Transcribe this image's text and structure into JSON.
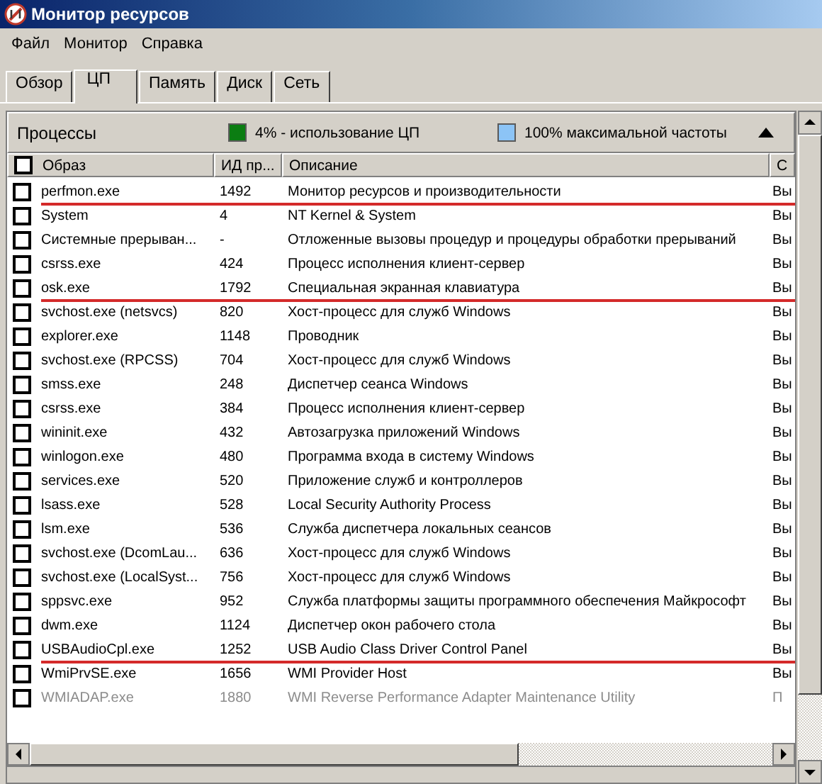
{
  "window": {
    "title": "Монитор ресурсов"
  },
  "menu": [
    "Файл",
    "Монитор",
    "Справка"
  ],
  "tabs": [
    {
      "label": "Обзор",
      "selected": false
    },
    {
      "label": "ЦП",
      "selected": true
    },
    {
      "label": "Память",
      "selected": false
    },
    {
      "label": "Диск",
      "selected": false
    },
    {
      "label": "Сеть",
      "selected": false
    }
  ],
  "section": {
    "title": "Процессы",
    "expanded": true,
    "legend": [
      {
        "text": "4% - использование ЦП",
        "color": "#0b7d12"
      },
      {
        "text": "100% максимальной частоты",
        "color": "#8cc4f6"
      }
    ]
  },
  "table": {
    "columns": [
      "Образ",
      "ИД пр...",
      "Описание",
      "С"
    ],
    "all_checked": false,
    "rows": [
      {
        "image": "perfmon.exe",
        "pid": "1492",
        "description": "Монитор ресурсов и производительности",
        "column_4": "Вы",
        "checked": false,
        "greyed": false,
        "marked": true
      },
      {
        "image": "System",
        "pid": "4",
        "description": "NT Kernel & System",
        "column_4": "Вы",
        "checked": false,
        "greyed": false,
        "marked": false
      },
      {
        "image": "Системные прерыван...",
        "pid": "-",
        "description": "Отложенные вызовы процедур и процедуры обработки прерываний",
        "column_4": "Вы",
        "checked": false,
        "greyed": false,
        "marked": false
      },
      {
        "image": "csrss.exe",
        "pid": "424",
        "description": "Процесс исполнения клиент-сервер",
        "column_4": "Вы",
        "checked": false,
        "greyed": false,
        "marked": false
      },
      {
        "image": "osk.exe",
        "pid": "1792",
        "description": "Специальная экранная клавиатура",
        "column_4": "Вы",
        "checked": false,
        "greyed": false,
        "marked": true
      },
      {
        "image": "svchost.exe (netsvcs)",
        "pid": "820",
        "description": "Хост-процесс для служб Windows",
        "column_4": "Вы",
        "checked": false,
        "greyed": false,
        "marked": false
      },
      {
        "image": "explorer.exe",
        "pid": "1148",
        "description": "Проводник",
        "column_4": "Вы",
        "checked": false,
        "greyed": false,
        "marked": false
      },
      {
        "image": "svchost.exe (RPCSS)",
        "pid": "704",
        "description": "Хост-процесс для служб Windows",
        "column_4": "Вы",
        "checked": false,
        "greyed": false,
        "marked": false
      },
      {
        "image": "smss.exe",
        "pid": "248",
        "description": "Диспетчер сеанса  Windows",
        "column_4": "Вы",
        "checked": false,
        "greyed": false,
        "marked": false
      },
      {
        "image": "csrss.exe",
        "pid": "384",
        "description": "Процесс исполнения клиент-сервер",
        "column_4": "Вы",
        "checked": false,
        "greyed": false,
        "marked": false
      },
      {
        "image": "wininit.exe",
        "pid": "432",
        "description": "Автозагрузка приложений Windows",
        "column_4": "Вы",
        "checked": false,
        "greyed": false,
        "marked": false
      },
      {
        "image": "winlogon.exe",
        "pid": "480",
        "description": "Программа входа в систему Windows",
        "column_4": "Вы",
        "checked": false,
        "greyed": false,
        "marked": false
      },
      {
        "image": "services.exe",
        "pid": "520",
        "description": "Приложение служб и контроллеров",
        "column_4": "Вы",
        "checked": false,
        "greyed": false,
        "marked": false
      },
      {
        "image": "lsass.exe",
        "pid": "528",
        "description": "Local Security Authority Process",
        "column_4": "Вы",
        "checked": false,
        "greyed": false,
        "marked": false
      },
      {
        "image": "lsm.exe",
        "pid": "536",
        "description": "Служба диспетчера локальных сеансов",
        "column_4": "Вы",
        "checked": false,
        "greyed": false,
        "marked": false
      },
      {
        "image": "svchost.exe (DcomLau...",
        "pid": "636",
        "description": "Хост-процесс для служб Windows",
        "column_4": "Вы",
        "checked": false,
        "greyed": false,
        "marked": false
      },
      {
        "image": "svchost.exe (LocalSyst...",
        "pid": "756",
        "description": "Хост-процесс для служб Windows",
        "column_4": "Вы",
        "checked": false,
        "greyed": false,
        "marked": false
      },
      {
        "image": "sppsvc.exe",
        "pid": "952",
        "description": "Служба платформы защиты программного обеспечения Майкрософт",
        "column_4": "Вы",
        "checked": false,
        "greyed": false,
        "marked": false
      },
      {
        "image": "dwm.exe",
        "pid": "1124",
        "description": "Диспетчер окон рабочего стола",
        "column_4": "Вы",
        "checked": false,
        "greyed": false,
        "marked": false
      },
      {
        "image": "USBAudioCpl.exe",
        "pid": "1252",
        "description": "USB Audio Class Driver Control Panel",
        "column_4": "Вы",
        "checked": false,
        "greyed": false,
        "marked": true
      },
      {
        "image": "WmiPrvSE.exe",
        "pid": "1656",
        "description": "WMI Provider Host",
        "column_4": "Вы",
        "checked": false,
        "greyed": false,
        "marked": false
      },
      {
        "image": "WMIADAP.exe",
        "pid": "1880",
        "description": "WMI Reverse Performance Adapter Maintenance Utility",
        "column_4": "П",
        "checked": false,
        "greyed": true,
        "marked": false
      }
    ]
  }
}
